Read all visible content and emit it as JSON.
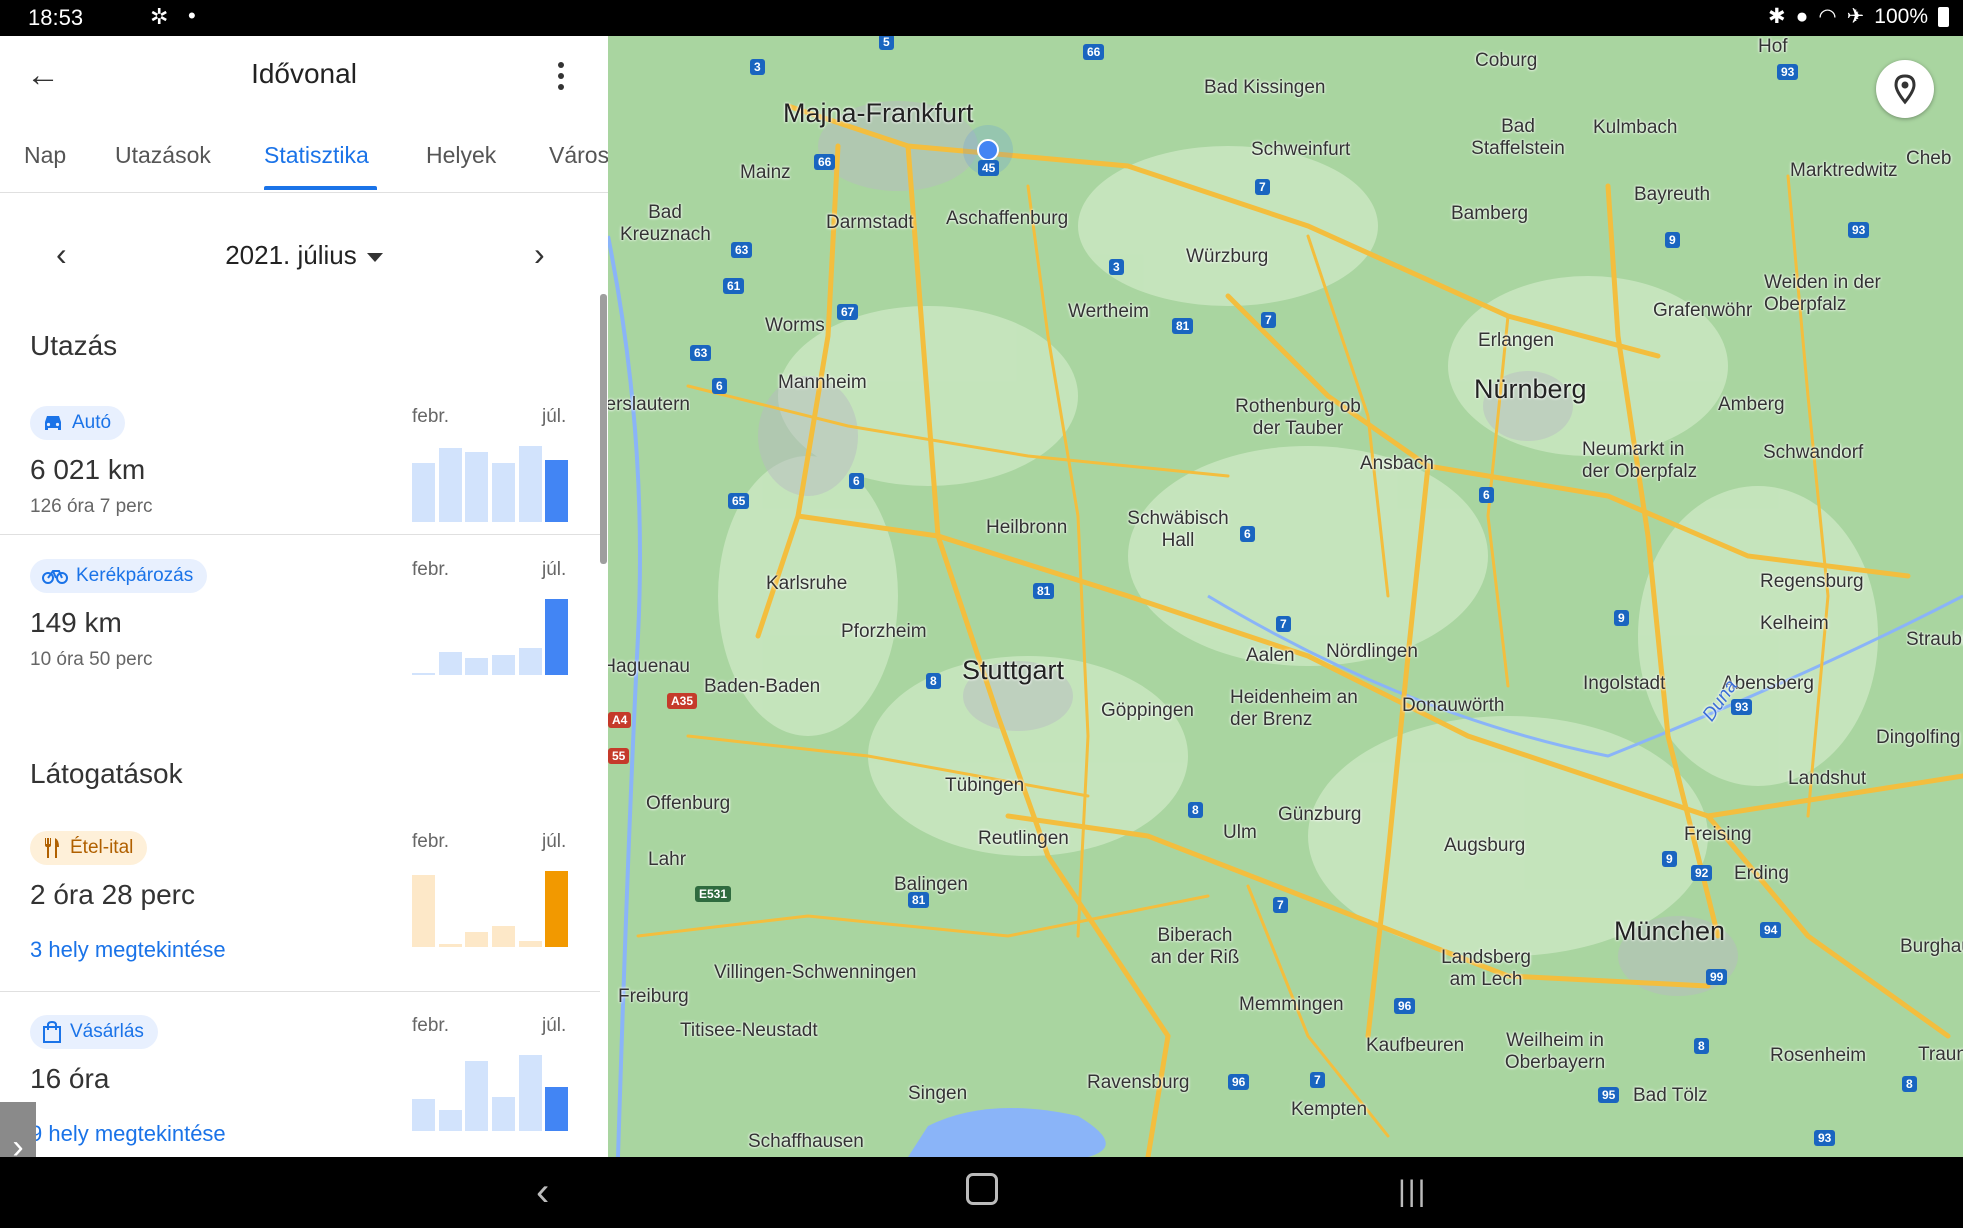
{
  "status_bar": {
    "time": "18:53",
    "battery": "100%"
  },
  "app_bar": {
    "title": "Idővonal"
  },
  "tabs": [
    {
      "label": "Nap"
    },
    {
      "label": "Utazások"
    },
    {
      "label": "Statisztika",
      "active": true
    },
    {
      "label": "Helyek"
    },
    {
      "label": "Város"
    }
  ],
  "month_nav": {
    "label": "2021. július"
  },
  "travel": {
    "title": "Utazás",
    "items": [
      {
        "chip": "Autó",
        "icon": "car-icon",
        "value": "6 021 km",
        "sub": "126 óra 7 perc",
        "chart": {
          "start_label": "febr.",
          "end_label": "júl.",
          "values": [
            0.78,
            0.98,
            0.92,
            0.78,
            1.0,
            0.82
          ]
        }
      },
      {
        "chip": "Kerékpározás",
        "icon": "bike-icon",
        "value": "149 km",
        "sub": "10 óra 50 perc",
        "chart": {
          "start_label": "febr.",
          "end_label": "júl.",
          "values": [
            0.02,
            0.3,
            0.22,
            0.26,
            0.36,
            1.0
          ]
        }
      }
    ]
  },
  "visits": {
    "title": "Látogatások",
    "items": [
      {
        "chip": "Étel-ital",
        "icon": "fork-knife-icon",
        "value": "2 óra 28 perc",
        "link": "3 hely megtekintése",
        "chart": {
          "start_label": "febr.",
          "end_label": "júl.",
          "values": [
            0.95,
            0.04,
            0.2,
            0.28,
            0.08,
            1.0
          ]
        }
      },
      {
        "chip": "Vásárlás",
        "icon": "shopping-bag-icon",
        "value": "16 óra",
        "link": "9 hely megtekintése",
        "chart": {
          "start_label": "febr.",
          "end_label": "júl.",
          "values": [
            0.42,
            0.27,
            0.92,
            0.45,
            1.0,
            0.58
          ]
        }
      }
    ]
  },
  "colors": {
    "accent": "#1a73e8",
    "bar_light_blue": "#d2e3fc",
    "bar_blue": "#4285f4",
    "bar_light_orange": "#fde8c8",
    "bar_orange": "#f29900",
    "map_green": "#a7d49e",
    "road_yellow": "#f6c243"
  },
  "map": {
    "cities": [
      {
        "name": "Majna-Frankfurt",
        "big": true
      },
      {
        "name": "Mainz"
      },
      {
        "name": "Darmstadt"
      },
      {
        "name": "Aschaffenburg"
      },
      {
        "name": "Bad Kissingen"
      },
      {
        "name": "Coburg"
      },
      {
        "name": "Bad Staffelstein"
      },
      {
        "name": "Kulmbach"
      },
      {
        "name": "Schweinfurt"
      },
      {
        "name": "Bamberg"
      },
      {
        "name": "Bayreuth"
      },
      {
        "name": "Marktredwitz"
      },
      {
        "name": "Cheb"
      },
      {
        "name": "Bad Kreuznach"
      },
      {
        "name": "Würzburg"
      },
      {
        "name": "Wertheim"
      },
      {
        "name": "Worms"
      },
      {
        "name": "Mannheim"
      },
      {
        "name": "Erlangen"
      },
      {
        "name": "Grafenwöhr"
      },
      {
        "name": "Weiden in der Oberpfalz"
      },
      {
        "name": "Nürnberg",
        "big": true
      },
      {
        "name": "Amberg"
      },
      {
        "name": "Rothenburg ob der Tauber"
      },
      {
        "name": "Ansbach"
      },
      {
        "name": "Neumarkt in der Oberpfalz"
      },
      {
        "name": "Schwandorf"
      },
      {
        "name": "Kaiserslautern"
      },
      {
        "name": "Heilbronn"
      },
      {
        "name": "Schwäbisch Hall"
      },
      {
        "name": "Karlsruhe"
      },
      {
        "name": "Regensburg"
      },
      {
        "name": "Pforzheim"
      },
      {
        "name": "Kelheim"
      },
      {
        "name": "Stuttgart",
        "big": true
      },
      {
        "name": "Aalen"
      },
      {
        "name": "Nördlingen"
      },
      {
        "name": "Haguenau"
      },
      {
        "name": "Baden-Baden"
      },
      {
        "name": "Göppingen"
      },
      {
        "name": "Heidenheim an der Brenz"
      },
      {
        "name": "Donauwörth"
      },
      {
        "name": "Ingolstadt"
      },
      {
        "name": "Abensberg"
      },
      {
        "name": "Straubing"
      },
      {
        "name": "Dingolfing"
      },
      {
        "name": "Offenburg"
      },
      {
        "name": "Tübingen"
      },
      {
        "name": "Günzburg"
      },
      {
        "name": "Landshut"
      },
      {
        "name": "Reutlingen"
      },
      {
        "name": "Ulm"
      },
      {
        "name": "Augsburg"
      },
      {
        "name": "Freising"
      },
      {
        "name": "Erding"
      },
      {
        "name": "Lahr"
      },
      {
        "name": "Balingen"
      },
      {
        "name": "Biberach an der Riß"
      },
      {
        "name": "München",
        "big": true
      },
      {
        "name": "Burghausen"
      },
      {
        "name": "Villingen-Schwenningen"
      },
      {
        "name": "Landsberg am Lech"
      },
      {
        "name": "Freiburg"
      },
      {
        "name": "Memmingen"
      },
      {
        "name": "Titisee-Neustadt"
      },
      {
        "name": "Kaufbeuren"
      },
      {
        "name": "Weilheim in Oberbayern"
      },
      {
        "name": "Rosenheim"
      },
      {
        "name": "Traunstein"
      },
      {
        "name": "Singen"
      },
      {
        "name": "Ravensburg"
      },
      {
        "name": "Kempten"
      },
      {
        "name": "Bad Tölz"
      },
      {
        "name": "Schaffhausen"
      },
      {
        "name": "Duna"
      },
      {
        "name": "Hof"
      }
    ],
    "shields": [
      "5",
      "66",
      "3",
      "66",
      "45",
      "7",
      "93",
      "93",
      "63",
      "61",
      "67",
      "3",
      "81",
      "7",
      "9",
      "63",
      "6",
      "6",
      "6",
      "65",
      "6",
      "81",
      "9",
      "7",
      "8",
      "93",
      "A35",
      "A4",
      "55",
      "8",
      "9",
      "92",
      "94",
      "7",
      "81",
      "E531",
      "99",
      "96",
      "8",
      "96",
      "7",
      "95",
      "8",
      "93"
    ]
  }
}
